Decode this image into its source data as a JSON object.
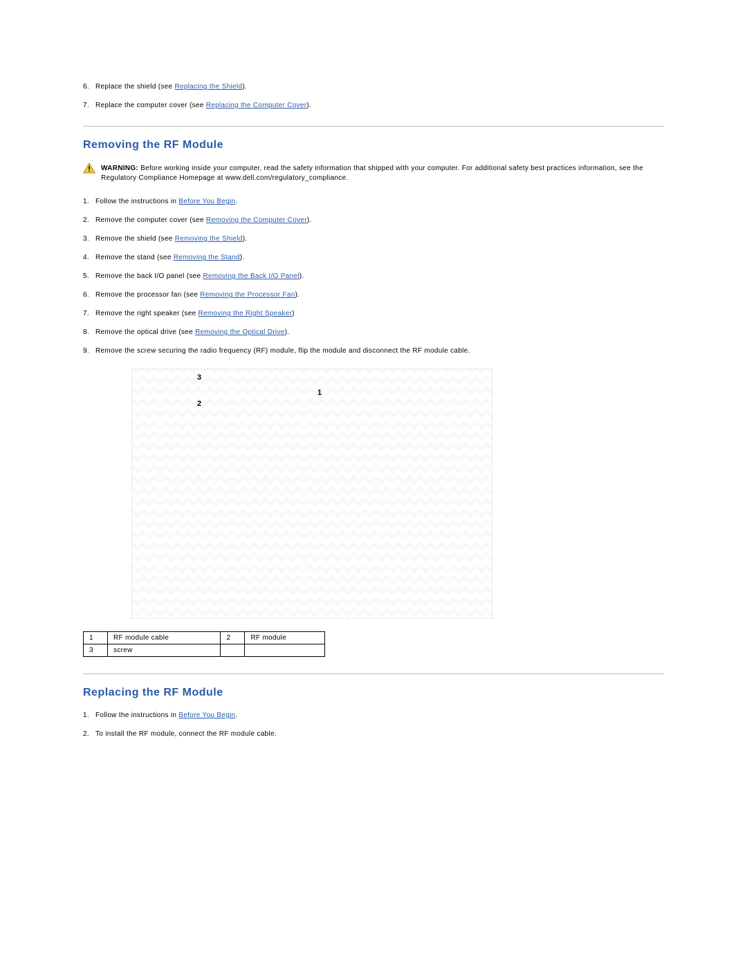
{
  "top_steps": [
    {
      "n": "6.",
      "pre": "Replace the shield (see ",
      "link": "Replacing the Shield",
      "post": ")."
    },
    {
      "n": "7.",
      "pre": "Replace the computer cover (see ",
      "link": "Replacing the Computer Cover",
      "post": ")."
    }
  ],
  "section1": {
    "heading": "Removing the RF Module",
    "warning_label": "WARNING:",
    "warning_text": " Before working inside your computer, read the safety information that shipped with your computer. For additional safety best practices information, see the Regulatory Compliance Homepage at www.dell.com/regulatory_compliance.",
    "steps": [
      {
        "n": "1.",
        "pre": "Follow the instructions in ",
        "link": "Before You Begin",
        "post": "."
      },
      {
        "n": "2.",
        "pre": "Remove the computer cover (see ",
        "link": "Removing the Computer Cover",
        "post": ")."
      },
      {
        "n": "3.",
        "pre": "Remove the shield (see ",
        "link": "Removing the Shield",
        "post": ")."
      },
      {
        "n": "4.",
        "pre": "Remove the stand (see ",
        "link": "Removing the Stand",
        "post": ")."
      },
      {
        "n": "5.",
        "pre": "Remove the back I/O panel (see ",
        "link": "Removing the Back I/O Panel",
        "post": ")."
      },
      {
        "n": "6.",
        "pre": "Remove the processor fan (see ",
        "link": "Removing the Processor Fan",
        "post": ")."
      },
      {
        "n": "7.",
        "pre": "Remove the right speaker (see ",
        "link": "Removing the Right Speaker",
        "post": ")"
      },
      {
        "n": "8.",
        "pre": "Remove the optical drive (see ",
        "link": "Removing the Optical Drive",
        "post": ")."
      },
      {
        "n": "9.",
        "pre": "Remove the screw securing the radio frequency (RF) module, flip the module and disconnect the RF module cable.",
        "link": "",
        "post": ""
      }
    ],
    "diagram_callouts": {
      "c1": "1",
      "c2": "2",
      "c3": "3"
    },
    "legend": [
      {
        "n": "1",
        "label": "RF module cable"
      },
      {
        "n": "2",
        "label": "RF module"
      },
      {
        "n": "3",
        "label": "screw"
      }
    ]
  },
  "section2": {
    "heading": "Replacing the RF Module",
    "steps": [
      {
        "n": "1.",
        "pre": "Follow the instructions in ",
        "link": "Before You Begin",
        "post": "."
      },
      {
        "n": "2.",
        "pre": "To install the RF module, connect the RF module cable.",
        "link": "",
        "post": ""
      }
    ]
  }
}
